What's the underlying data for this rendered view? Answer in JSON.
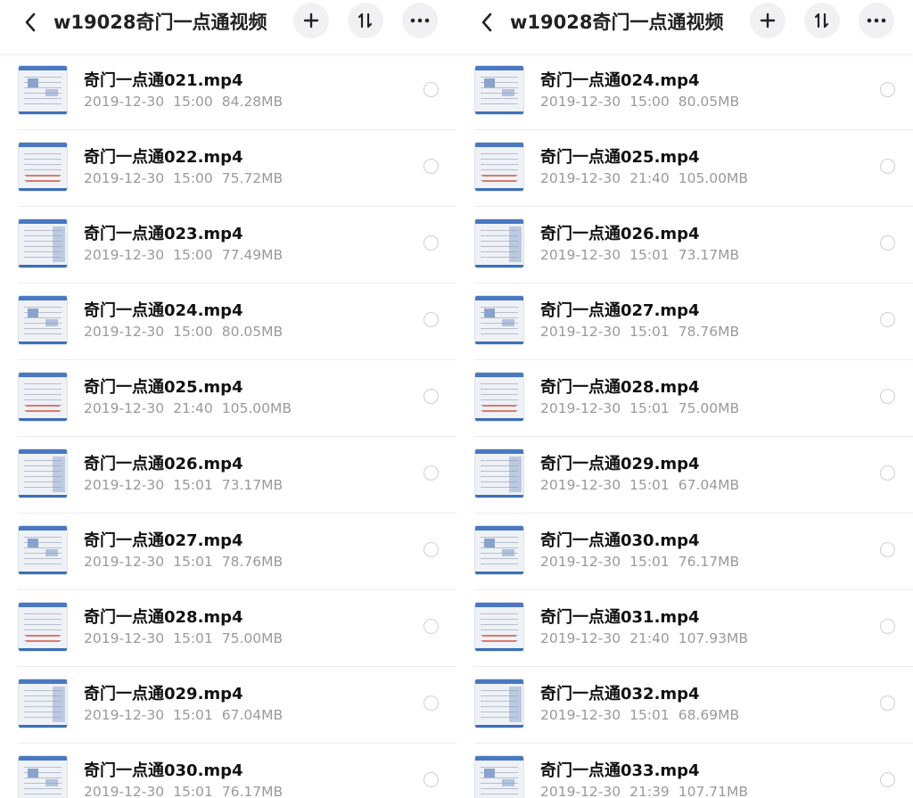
{
  "left": {
    "title": "w19028奇门一点通视频",
    "files": [
      {
        "name": "奇门一点通021.mp4",
        "date": "2019-12-30",
        "time": "15:00",
        "size": "84.28MB"
      },
      {
        "name": "奇门一点通022.mp4",
        "date": "2019-12-30",
        "time": "15:00",
        "size": "75.72MB"
      },
      {
        "name": "奇门一点通023.mp4",
        "date": "2019-12-30",
        "time": "15:00",
        "size": "77.49MB"
      },
      {
        "name": "奇门一点通024.mp4",
        "date": "2019-12-30",
        "time": "15:00",
        "size": "80.05MB"
      },
      {
        "name": "奇门一点通025.mp4",
        "date": "2019-12-30",
        "time": "21:40",
        "size": "105.00MB"
      },
      {
        "name": "奇门一点通026.mp4",
        "date": "2019-12-30",
        "time": "15:01",
        "size": "73.17MB"
      },
      {
        "name": "奇门一点通027.mp4",
        "date": "2019-12-30",
        "time": "15:01",
        "size": "78.76MB"
      },
      {
        "name": "奇门一点通028.mp4",
        "date": "2019-12-30",
        "time": "15:01",
        "size": "75.00MB"
      },
      {
        "name": "奇门一点通029.mp4",
        "date": "2019-12-30",
        "time": "15:01",
        "size": "67.04MB"
      },
      {
        "name": "奇门一点通030.mp4",
        "date": "2019-12-30",
        "time": "15:01",
        "size": "76.17MB"
      }
    ]
  },
  "right": {
    "title": "w19028奇门一点通视频",
    "files": [
      {
        "name": "奇门一点通024.mp4",
        "date": "2019-12-30",
        "time": "15:00",
        "size": "80.05MB"
      },
      {
        "name": "奇门一点通025.mp4",
        "date": "2019-12-30",
        "time": "21:40",
        "size": "105.00MB"
      },
      {
        "name": "奇门一点通026.mp4",
        "date": "2019-12-30",
        "time": "15:01",
        "size": "73.17MB"
      },
      {
        "name": "奇门一点通027.mp4",
        "date": "2019-12-30",
        "time": "15:01",
        "size": "78.76MB"
      },
      {
        "name": "奇门一点通028.mp4",
        "date": "2019-12-30",
        "time": "15:01",
        "size": "75.00MB"
      },
      {
        "name": "奇门一点通029.mp4",
        "date": "2019-12-30",
        "time": "15:01",
        "size": "67.04MB"
      },
      {
        "name": "奇门一点通030.mp4",
        "date": "2019-12-30",
        "time": "15:01",
        "size": "76.17MB"
      },
      {
        "name": "奇门一点通031.mp4",
        "date": "2019-12-30",
        "time": "21:40",
        "size": "107.93MB"
      },
      {
        "name": "奇门一点通032.mp4",
        "date": "2019-12-30",
        "time": "15:01",
        "size": "68.69MB"
      },
      {
        "name": "奇门一点通033.mp4",
        "date": "2019-12-30",
        "time": "21:39",
        "size": "107.71MB"
      }
    ]
  },
  "icons": {
    "back": "chevron-left-icon",
    "add": "plus-icon",
    "sort": "sort-icon",
    "more": "more-horizontal-icon",
    "thumbnail": "video-thumbnail-icon",
    "select": "radio-circle-icon"
  }
}
